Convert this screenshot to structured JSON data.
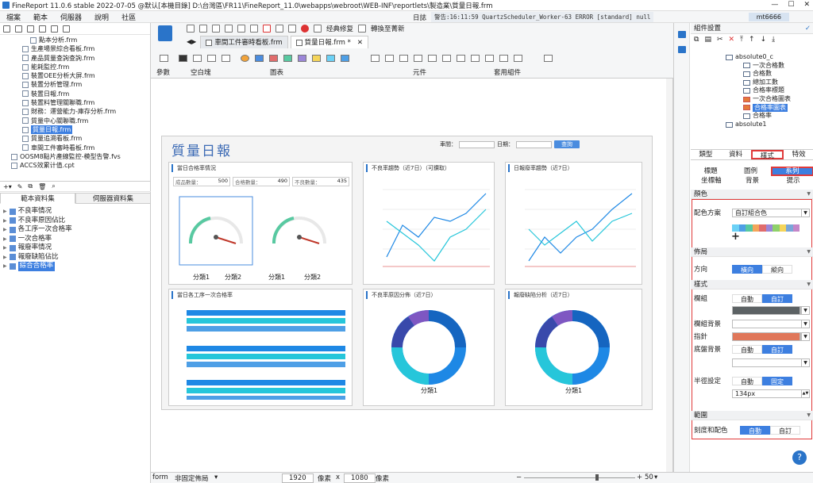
{
  "window": {
    "title": "FineReport 11.0.6 stable 2022-07-05 @默认[本機目錄]    D:\\台灣區\\FR11\\FineReport_11.0\\webapps\\webroot\\WEB-INF\\reportlets\\製造業\\質量日報.frm"
  },
  "menu": {
    "items": [
      "檔案",
      "範本",
      "伺服器",
      "說明",
      "社區"
    ],
    "log_label": "日誌",
    "log_text": "警告:16:11:59 QuartzScheduler_Worker-63 ERROR [standard] null",
    "user": "mt6666"
  },
  "files": [
    {
      "name": "點本分析.frm",
      "indent": 38
    },
    {
      "name": "生產場景綜合看板.frm",
      "indent": 28
    },
    {
      "name": "產品質量查詢查詢.frm",
      "indent": 28
    },
    {
      "name": "能耗監控.frm",
      "indent": 28
    },
    {
      "name": "裝置OEE分析大屏.frm",
      "indent": 28
    },
    {
      "name": "裝置分析管理.frm",
      "indent": 28
    },
    {
      "name": "裝置日報.frm",
      "indent": 28
    },
    {
      "name": "裝置料管理關聯職.frm",
      "indent": 28
    },
    {
      "name": "財務：運營能力-庫存分析.frm",
      "indent": 28
    },
    {
      "name": "質量中心關聯職.frm",
      "indent": 28
    },
    {
      "name": "質量日報.frm",
      "indent": 28,
      "selected": true
    },
    {
      "name": "質量追溯看板.frm",
      "indent": 28
    },
    {
      "name": "車間工件審時看板.frm",
      "indent": 28
    },
    {
      "name": "OOSM8點片產線監控-模型告警.fvs",
      "indent": 14
    },
    {
      "name": "ACCS效累计值.cpt",
      "indent": 14
    }
  ],
  "dataset_tabs": [
    "範本資料集",
    "伺服器資料集"
  ],
  "datasets": [
    {
      "name": "不良率情况"
    },
    {
      "name": "不良率原因佔比"
    },
    {
      "name": "各工序一次合格率"
    },
    {
      "name": "一次合格率"
    },
    {
      "name": "報廢率情况"
    },
    {
      "name": "報廢缺陷佔比"
    },
    {
      "name": "綜合合格率",
      "selected": true
    }
  ],
  "toolbar": {
    "btn1": "经典修复",
    "btn2": "轉換至菁新"
  },
  "file_tabs": [
    {
      "name": "車間工件審時看板.frm",
      "active": false
    },
    {
      "name": "質量日報.frm *",
      "active": true
    }
  ],
  "component_groups": [
    "參數",
    "空白塊",
    "圖表",
    "元件",
    "套用組件"
  ],
  "report": {
    "title": "質量日報",
    "filter_label1": "車間：",
    "filter_label2": "日期：",
    "query_btn": "查詢",
    "cards": [
      {
        "title": "當日合格率情況",
        "kpi1_label": "成品數量：",
        "kpi1_value": "500",
        "kpi2_label": "合格數量：",
        "kpi2_value": "490",
        "kpi3_label": "不良數量：",
        "kpi3_value": "435",
        "gauge1": "分類1",
        "gauge2": "分類2",
        "gauge3": "分類1",
        "gauge4": "分類2"
      },
      {
        "title": "不良率趨勢（近7日）（可鑽取）"
      },
      {
        "title": "日報廢率趨勢（近7日）"
      },
      {
        "title": "當日各工序一次合格率"
      },
      {
        "title": "不良率原因分佈（近7日）",
        "donut_label": "分類1"
      },
      {
        "title": "報廢缺陷分析（近7日）",
        "donut_label": "分類1"
      }
    ]
  },
  "status": {
    "mode": "form",
    "layout": "非固定佈局",
    "width": "1920",
    "w_unit": "像素",
    "x": "x",
    "height": "1080",
    "h_unit": "像素",
    "zoom": "50"
  },
  "right": {
    "header": "組件設置",
    "tree": [
      {
        "name": "absolute0_c",
        "indent": 44,
        "expand": true,
        "icon": "folder"
      },
      {
        "name": "一次合格數",
        "indent": 66
      },
      {
        "name": "合格數",
        "indent": 66
      },
      {
        "name": "總加工數",
        "indent": 66
      },
      {
        "name": "合格率標題",
        "indent": 66
      },
      {
        "name": "一次合格圖表",
        "indent": 66,
        "icon": "chart"
      },
      {
        "name": "合格率圖表",
        "indent": 66,
        "icon": "chart",
        "selected": true
      },
      {
        "name": "合格率",
        "indent": 66
      },
      {
        "name": "absolute1",
        "indent": 44,
        "icon": "folder"
      }
    ],
    "prop_tabs": [
      "類型",
      "資料",
      "樣式",
      "特效"
    ],
    "active_tab": "樣式",
    "sub_tabs_row1": [
      "標題",
      "圖例",
      "系列"
    ],
    "sub_tabs_row2": [
      "坐標軸",
      "背景",
      "提示"
    ],
    "active_sub": "系列",
    "sections": {
      "color": "顏色",
      "layout": "佈局",
      "style": "樣式",
      "range": "範圍"
    },
    "color_scheme_label": "配色方案",
    "color_scheme_value": "自訂組合色",
    "palette": [
      "#6bd1f6",
      "#4e9fe6",
      "#58c9a1",
      "#f4a55a",
      "#e06c6c",
      "#9b86d8",
      "#8fd16b",
      "#f5d55a",
      "#7aa6d8",
      "#c486c8"
    ],
    "plus": "+",
    "direction_label": "方向",
    "direction_opts": [
      "橫向",
      "縱向"
    ],
    "border_label": "欄組",
    "border_opts": [
      "自動",
      "自訂"
    ],
    "border_color": "#5c6264",
    "bg_label": "欄組背景",
    "pointer_label": "指針",
    "pointer_color": "#e0775a",
    "base_label": "底盤背景",
    "base_opts": [
      "自動",
      "自訂"
    ],
    "radius_label": "半徑設定",
    "radius_opts": [
      "自動",
      "固定"
    ],
    "radius_value": "134px",
    "scale_label": "刻度和配色",
    "scale_opts": [
      "自動",
      "自訂"
    ],
    "help": "?"
  }
}
